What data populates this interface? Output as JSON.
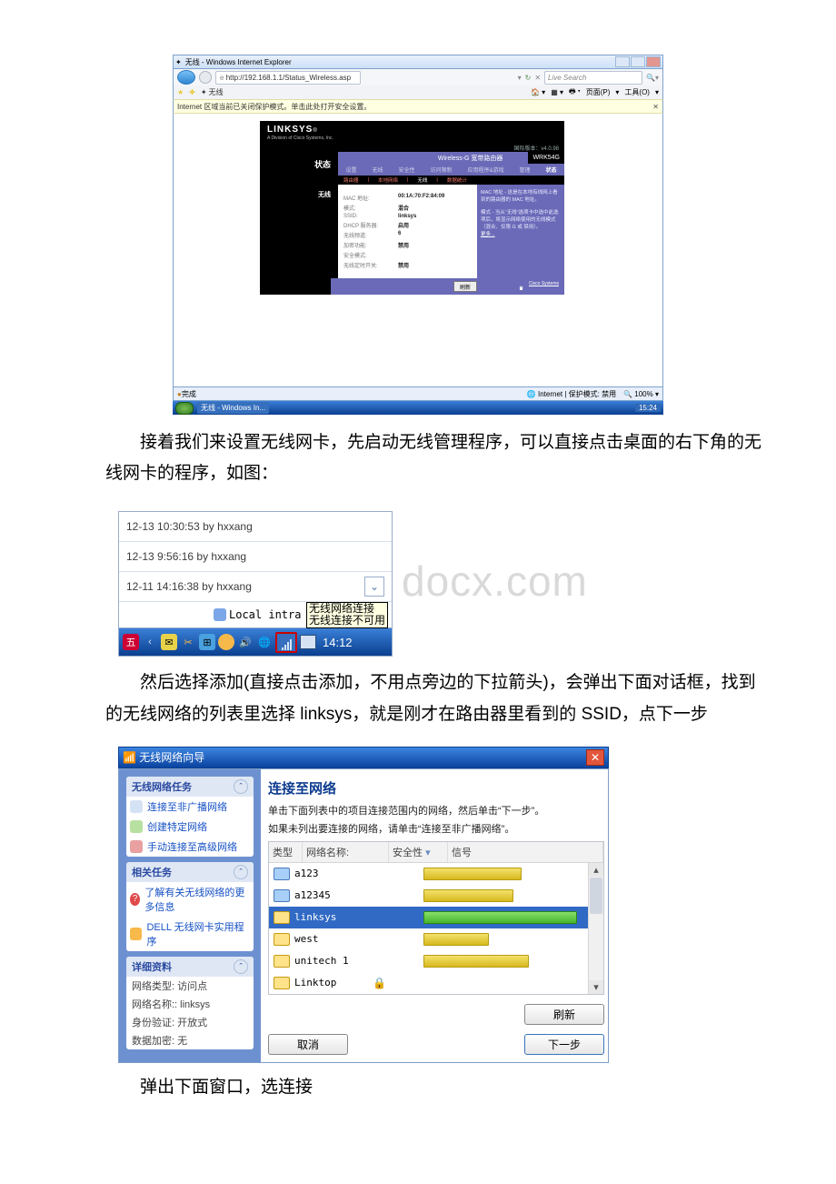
{
  "prose": {
    "p1": "接着我们来设置无线网卡，先启动无线管理程序，可以直接点击桌面的右下角的无线网卡的程序，如图：",
    "p2": "然后选择添加(直接点击添加，不用点旁边的下拉箭头)，会弹出下面对话框，找到的无线网络的列表里选择 linksys，就是刚才在路由器里看到的 SSID，点下一步",
    "p3": "弹出下面窗口，选连接"
  },
  "ie": {
    "title": "无线 - Windows Internet Explorer",
    "url": "http://192.168.1.1/Status_Wireless.asp",
    "search_placeholder": "Live Search",
    "favtab": "无线",
    "infobar": "Internet 区域当前已关闭保护模式。单击此处打开安全设置。",
    "toolbar_page": "页面(P)",
    "toolbar_tools": "工具(O)",
    "status_left": "完成",
    "status_zone": "Internet | 保护模式: 禁用",
    "status_zoom": "100%"
  },
  "linksys": {
    "brand": "LINKSYS",
    "brand_sub": "A Division of Cisco Systems, Inc.",
    "version": "国际版本：v4.0.98",
    "nav_title": "状态",
    "product": "Wireless-G 宽带路由器",
    "model": "WRK54G",
    "tabs": [
      "设置",
      "无线",
      "安全性",
      "访问限制",
      "应用程序&游戏",
      "管理",
      "状态"
    ],
    "subtabs": [
      "路由器",
      "本地网络",
      "无线",
      "数据统计"
    ],
    "side": "无线",
    "rows": [
      {
        "k": "MAC 地址:",
        "v": "00:1A:70:F2:84:09"
      },
      {
        "k": "模式:",
        "v": "混合"
      },
      {
        "k": "SSID:",
        "v": "linksys"
      },
      {
        "k": "DHCP 服务器:",
        "v": "启用"
      },
      {
        "k": "无线频道:",
        "v": "6"
      },
      {
        "k": "加密功能:",
        "v": "禁用"
      },
      {
        "k": "安全模式:",
        "v": ""
      },
      {
        "k": "无线定时开关:",
        "v": "禁用"
      }
    ],
    "help_mac": "MAC 地址 - 这是在本地有线网上看到的路由器的 MAC 地址。",
    "help_mode": "模式 - 当从“无线”选项卡中选中此选项后，将显示网络使用的无线模式（混合、仅限 G 或 禁用）。",
    "help_more": "更多...",
    "refresh": "刷新",
    "cisco": "Cisco Systems"
  },
  "tray": {
    "items": [
      "12-13 10:30:53 by hxxang",
      "12-13 9:56:16 by hxxang",
      "12-11 14:16:38 by hxxang"
    ],
    "local": "Local intra",
    "tooltip_l1": "无线网络连接",
    "tooltip_l2": "无线连接不可用",
    "clock": "14:12"
  },
  "watermark": "docx.com",
  "wizard": {
    "title": "无线网络向导",
    "sections": {
      "tasks": {
        "h": "无线网络任务",
        "links": [
          "连接至非广播网络",
          "创建特定网络",
          "手动连接至高级网络"
        ]
      },
      "related": {
        "h": "相关任务",
        "links": [
          "了解有关无线网络的更多信息",
          "DELL 无线网卡实用程序"
        ]
      },
      "details": {
        "h": "详细资料",
        "rows": [
          "网络类型: 访问点",
          "网络名称:: linksys",
          "身份验证: 开放式",
          "数据加密: 无"
        ]
      }
    },
    "right": {
      "h1": "连接至网络",
      "t1": "单击下面列表中的项目连接范围内的网络，然后单击“下一步”。",
      "t2": "如果未列出要连接的网络，请单击“连接至非广播网络”。",
      "cols": [
        "类型",
        "网络名称:",
        "安全性",
        "信号"
      ],
      "rows": [
        {
          "name": "a123",
          "sec": "",
          "sig": 60,
          "sel": false,
          "ico": "blue"
        },
        {
          "name": "a12345",
          "sec": "",
          "sig": 55,
          "sel": false,
          "ico": "blue"
        },
        {
          "name": "linksys",
          "sec": "",
          "sig": 95,
          "sel": true,
          "ico": "y"
        },
        {
          "name": "west",
          "sec": "",
          "sig": 40,
          "sel": false,
          "ico": "y"
        },
        {
          "name": "unitech 1",
          "sec": "",
          "sig": 65,
          "sel": false,
          "ico": "y"
        },
        {
          "name": "Linktop",
          "sec": "lock",
          "sig": 0,
          "sel": false,
          "ico": "y"
        }
      ],
      "refresh": "刷新",
      "cancel": "取消",
      "next": "下一步"
    }
  },
  "taskbar": {
    "item": "无线 - Windows In...",
    "clock": "15:24"
  }
}
